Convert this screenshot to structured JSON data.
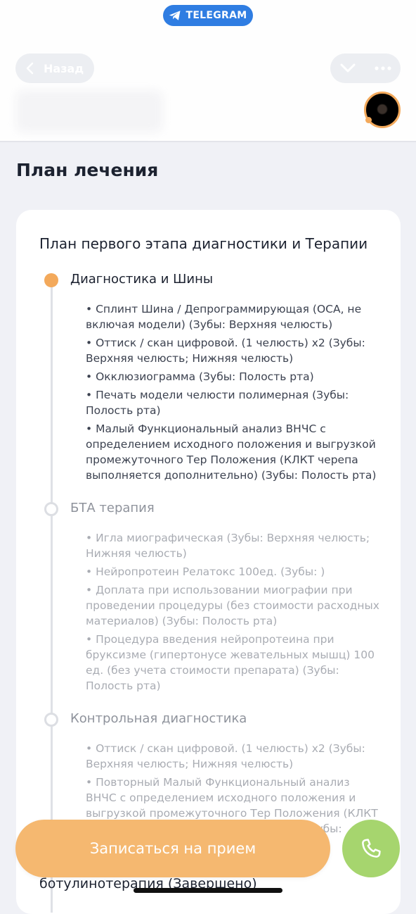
{
  "telegram_badge": "TELEGRAM",
  "header": {
    "back_label": "Назад"
  },
  "page_title": "План лечения",
  "plan": {
    "title": "План первого этапа диагностики и Терапии",
    "stages": [
      {
        "title": "Диагностика и Шины",
        "status": "active",
        "items": [
          "• Сплинт Шина / Депрограммирующая (ОСА, не включая модели) (Зубы: Верхняя челюсть)",
          "• Оттиск / скан цифровой. (1 челюсть) x2 (Зубы: Верхняя челюсть; Нижняя челюсть)",
          "• Окклюзиограмма (Зубы: Полость рта)",
          "• Печать модели челюсти полимерная (Зубы: Полость рта)",
          "• Малый Функциональный анализ ВНЧС с определением исходного положения и выгрузкой промежуточного Тер Положения (КЛКТ черепа выполняется дополнительно) (Зубы: Полость рта)"
        ]
      },
      {
        "title": "БТА терапия",
        "status": "pending",
        "items": [
          "• Игла миографическая (Зубы: Верхняя челюсть; Нижняя челюсть)",
          "• Нейропротеин Релатокс 100ед. (Зубы: )",
          "• Доплата при использовании миографии при проведении процедуры (без стоимости расходных материалов) (Зубы: Полость рта)",
          "• Процедура введения нейропротеина при бруксизме (гипертонусе жевательных мышц) 100 ед. (без учета стоимости препарата) (Зубы: Полость рта)"
        ]
      },
      {
        "title": "Контрольная диагностика",
        "status": "pending",
        "items": [
          "• Оттиск / скан цифровой. (1 челюсть) x2 (Зубы: Верхняя челюсть; Нижняя челюсть)",
          "• Повторный Малый Функциональный анализ ВНЧС с определением исходного положения и выгрузкой промежуточного Тер Положения (КЛКТ черепа выполняется дополнительно) (Зубы: Полость рта)"
        ]
      }
    ],
    "next_stage_title": "ботулинотерапия (Завершено)"
  },
  "cta_label": "Записаться на прием",
  "icons": {
    "telegram": "telegram-plane-icon",
    "back": "chevron-left-icon",
    "collapse": "chevron-down-icon",
    "more": "more-dots-icon",
    "call": "phone-icon"
  },
  "colors": {
    "accent": "#f3a95b",
    "cta": "#f5b870",
    "call": "#a6d56e",
    "telegram": "#2f7de2"
  }
}
